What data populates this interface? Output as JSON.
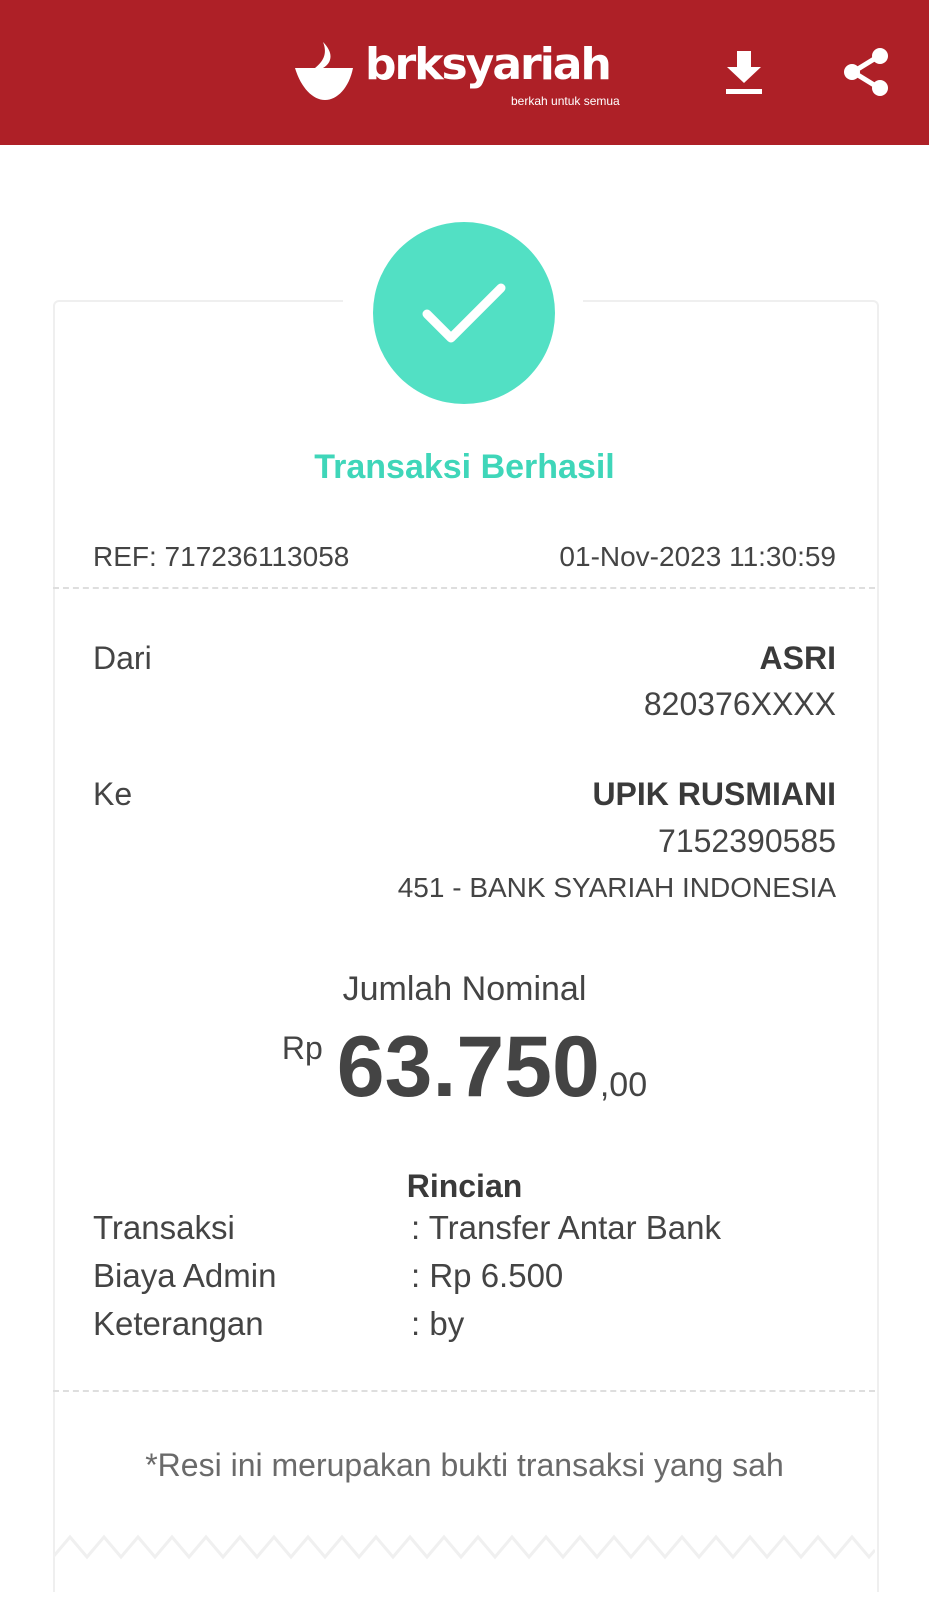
{
  "header": {
    "logo_text": "brksyariah",
    "logo_tagline": "berkah untuk semua",
    "colors": {
      "background": "#ae2027",
      "foreground": "#ffffff"
    },
    "icons": [
      "download-icon",
      "share-icon"
    ]
  },
  "status": {
    "title": "Transaksi Berhasil",
    "icon": "check-icon",
    "color": "#52e0c4"
  },
  "meta": {
    "ref": "REF: 717236113058",
    "datetime": "01-Nov-2023 11:30:59"
  },
  "from": {
    "label": "Dari",
    "name": "ASRI",
    "account": "820376XXXX"
  },
  "to": {
    "label": "Ke",
    "name": "UPIK RUSMIANI",
    "account": "7152390585",
    "bank": "451 - BANK SYARIAH INDONESIA"
  },
  "amount": {
    "label": "Jumlah Nominal",
    "currency": "Rp",
    "main": "63.750",
    "decimal": ",00"
  },
  "details": {
    "title": "Rincian",
    "rows": [
      {
        "key": "Transaksi",
        "value": ": Transfer Antar Bank"
      },
      {
        "key": "Biaya Admin",
        "value": ": Rp 6.500"
      },
      {
        "key": "Keterangan",
        "value": ": by"
      }
    ]
  },
  "footer": {
    "note": "*Resi ini merupakan bukti transaksi yang sah"
  }
}
